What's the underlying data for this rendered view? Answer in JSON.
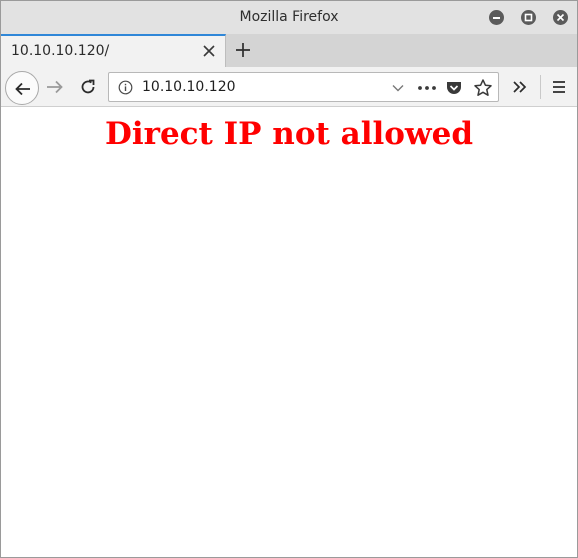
{
  "window": {
    "title": "Mozilla Firefox"
  },
  "tabs": [
    {
      "label": "10.10.10.120/"
    }
  ],
  "urlbar": {
    "url": "10.10.10.120"
  },
  "page": {
    "heading": "Direct IP not allowed",
    "heading_color": "#ff0000"
  },
  "colors": {
    "tab_accent": "#2f87d8",
    "window_control": "#5b5b5b"
  },
  "icons": {
    "window_controls": [
      "minimize-icon",
      "maximize-icon",
      "close-icon"
    ],
    "toolbar": [
      "back-arrow-icon",
      "forward-arrow-icon",
      "reload-icon",
      "info-icon",
      "chevron-down-icon",
      "more-dots-icon",
      "pocket-icon",
      "star-icon",
      "overflow-chevrons-icon",
      "hamburger-menu-icon"
    ]
  }
}
